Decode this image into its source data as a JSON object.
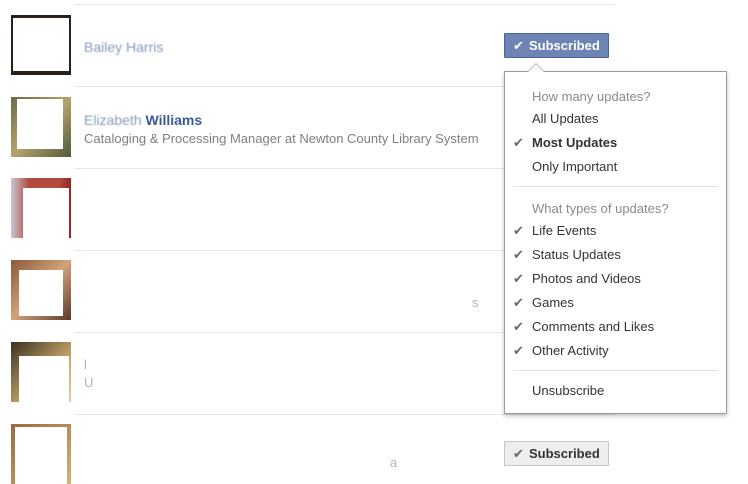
{
  "rows": [
    {
      "name_blurred": "Bailey Harris",
      "subtitle": "",
      "button": {
        "label": "Subscribed",
        "check": "✔",
        "state": "active"
      }
    },
    {
      "name_blurred": "Elizabeth",
      "name_visible": "Williams",
      "subtitle": "Cataloging & Processing Manager at Newton County Library System"
    },
    {
      "name_blurred": "",
      "subtitle": ""
    },
    {
      "name_blurred": "",
      "subtitle": "",
      "trailing": "s"
    },
    {
      "name_blurred": "l",
      "subtitle": "U"
    },
    {
      "name_blurred": "",
      "subtitle": "a",
      "button": {
        "label": "Subscribed",
        "check": "✔",
        "state": "normal"
      }
    }
  ],
  "menu": {
    "section1_title": "How many updates?",
    "frequency_options": [
      {
        "label": "All Updates",
        "checked": false,
        "bold": false
      },
      {
        "label": "Most Updates",
        "checked": true,
        "bold": true
      },
      {
        "label": "Only Important",
        "checked": false,
        "bold": false
      }
    ],
    "section2_title": "What types of updates?",
    "type_options": [
      {
        "label": "Life Events",
        "checked": true
      },
      {
        "label": "Status Updates",
        "checked": true
      },
      {
        "label": "Photos and Videos",
        "checked": true
      },
      {
        "label": "Games",
        "checked": true
      },
      {
        "label": "Comments and Likes",
        "checked": true
      },
      {
        "label": "Other Activity",
        "checked": true
      }
    ],
    "unsubscribe_label": "Unsubscribe",
    "check_glyph": "✔"
  },
  "colors": {
    "link_blue": "#3b5998",
    "button_active_bg": "#6d84b4",
    "button_normal_bg": "#eeeeee",
    "divider": "#e5e5e5"
  }
}
